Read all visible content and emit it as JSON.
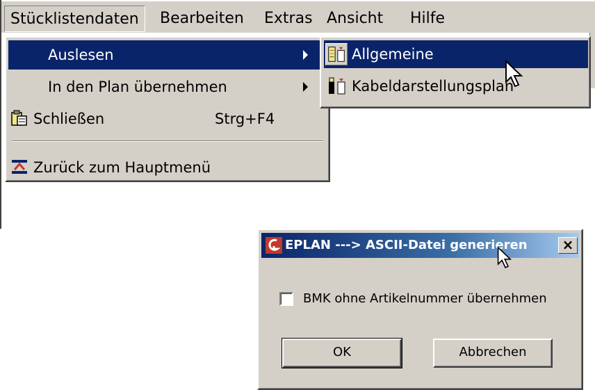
{
  "menubar": {
    "items": [
      {
        "label": "Stücklistendaten"
      },
      {
        "label": "Bearbeiten"
      },
      {
        "label": "Extras"
      },
      {
        "label": "Ansicht"
      },
      {
        "label": "Hilfe"
      }
    ]
  },
  "dropdown": {
    "items": [
      {
        "label": "Auslesen",
        "has_submenu": true,
        "selected": true
      },
      {
        "label": "In den Plan übernehmen",
        "has_submenu": true
      },
      {
        "label": "Schließen",
        "shortcut": "Strg+F4",
        "icon": "close-document-icon"
      },
      {
        "label": "Zurück zum Hauptmenü",
        "icon": "main-menu-icon"
      }
    ]
  },
  "submenu": {
    "items": [
      {
        "label": "Allgemeine",
        "icon": "parts-list-general-icon",
        "selected": true
      },
      {
        "label": "Kabeldarstellungsplan",
        "icon": "cable-plan-icon"
      }
    ]
  },
  "dialog": {
    "title": "EPLAN ---> ASCII-Datei generieren",
    "close_label": "×",
    "checkbox_label": "BMK ohne Artikelnummer übernehmen",
    "checkbox_checked": false,
    "ok_label": "OK",
    "cancel_label": "Abbrechen"
  },
  "colors": {
    "menu_face": "#d4d0c8",
    "highlight": "#0a246a",
    "title_gradient_end": "#a6caf0"
  }
}
